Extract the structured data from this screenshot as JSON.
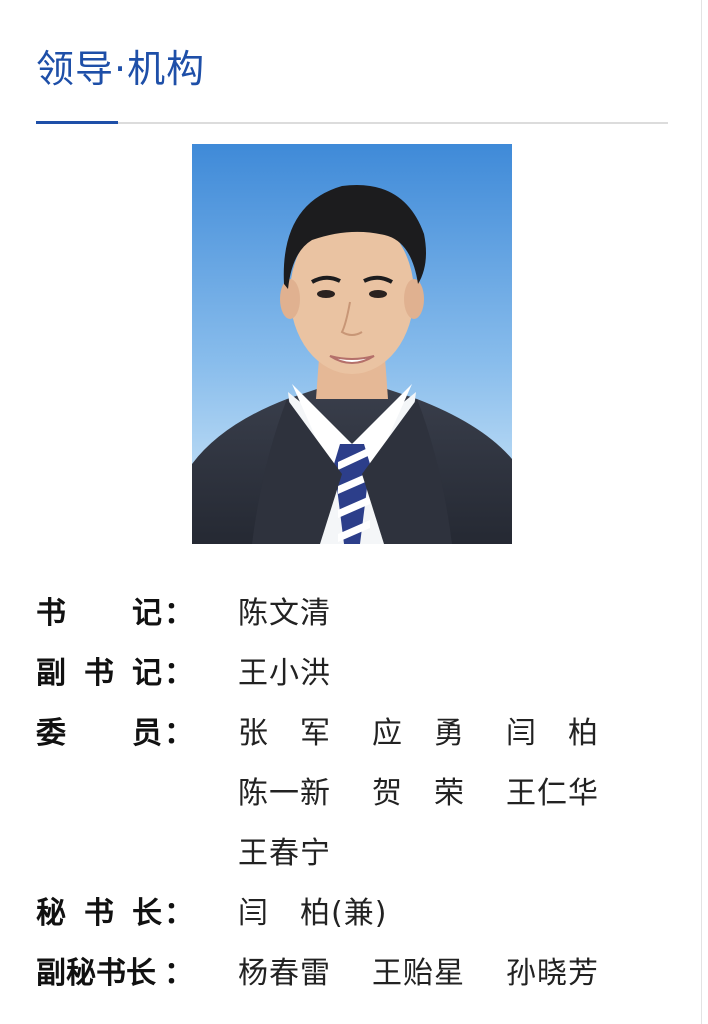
{
  "section": {
    "title": "领导·机构"
  },
  "portrait": {
    "icon": "leader-portrait-photo",
    "background_top": "#3f8ad8",
    "background_bottom": "#d7ecfa"
  },
  "roster": {
    "secretary": {
      "label_chars": [
        "书",
        "记"
      ],
      "colon": "：",
      "names": [
        "陈文清"
      ]
    },
    "deputy_secretary": {
      "label_chars": [
        "副",
        "书",
        "记"
      ],
      "colon": "：",
      "names": [
        "王小洪"
      ]
    },
    "members": {
      "label_chars": [
        "委",
        "员"
      ],
      "colon": "：",
      "names": [
        "张　军",
        "应　勇",
        "闫　柏",
        "陈一新",
        "贺　荣",
        "王仁华",
        "王春宁"
      ]
    },
    "secretary_general": {
      "label_chars": [
        "秘",
        "书",
        "长"
      ],
      "colon": "：",
      "names": [
        "闫　柏(兼)"
      ]
    },
    "deputy_secretary_general": {
      "label_text": "副秘书长",
      "colon": "：",
      "names": [
        "杨春雷",
        "王贻星",
        "孙晓芳"
      ]
    }
  },
  "colors": {
    "title": "#1e4fa8",
    "label": "#111111",
    "name": "#222222"
  }
}
